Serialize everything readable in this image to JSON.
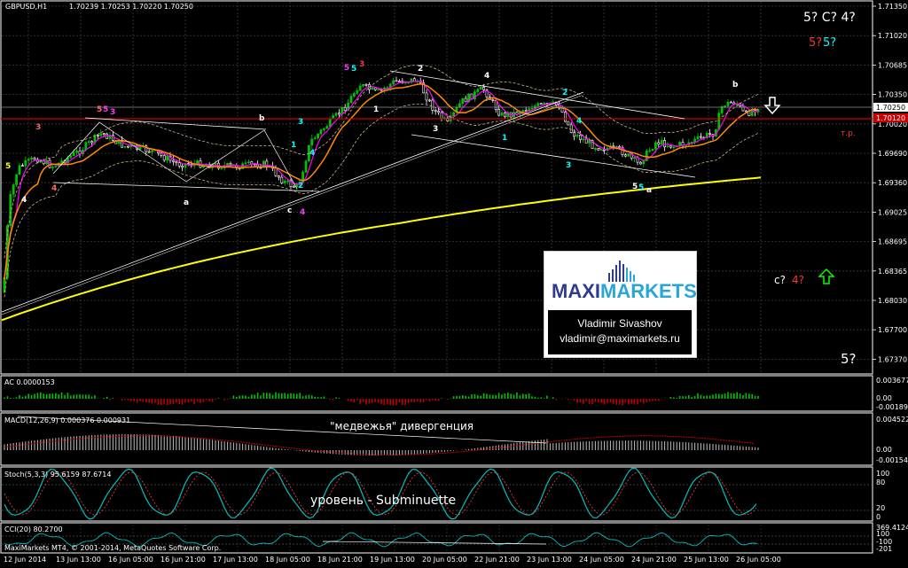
{
  "window": {
    "title": "GBPUSD,H1",
    "ohlc": "1.70239 1.70253 1.70220 1.70250"
  },
  "price_axis": {
    "ticks": [
      "1.71350",
      "1.71020",
      "1.70685",
      "1.70350",
      "1.70020",
      "1.69690",
      "1.69360",
      "1.69025",
      "1.68695",
      "1.68365",
      "1.68030",
      "1.67700",
      "1.67370"
    ],
    "current_price": "1.70250",
    "level_price": "1.70120"
  },
  "time_axis": {
    "ticks": [
      "12 Jun 2014",
      "13 Jun 13:00",
      "16 Jun 05:00",
      "16 Jun 21:00",
      "17 Jun 13:00",
      "18 Jun 05:00",
      "18 Jun 21:00",
      "19 Jun 13:00",
      "20 Jun 05:00",
      "22 Jun 21:00",
      "23 Jun 13:00",
      "24 Jun 05:00",
      "24 Jun 21:00",
      "25 Jun 13:00",
      "26 Jun 05:00"
    ]
  },
  "annotations": {
    "top_right": "5? C? 4?",
    "top_right2_a": "5?",
    "top_right2_b": "5?",
    "tp": "т.р.",
    "c4_a": "c?",
    "c4_b": "4?",
    "bottom_right": "5?",
    "bearish": "\"медвежья\" дивергенция",
    "level": "уровень - Subminuette"
  },
  "wave_labels": {
    "a1": "a",
    "b1": "b",
    "c1": "c",
    "four1": "4",
    "five_top": "5",
    "five_top_b": "5",
    "three_top": "3",
    "two_1": "2",
    "four_2": "4",
    "three_2": "3",
    "one_2": "1",
    "two_3": "2",
    "four_3": "4",
    "one_3": "1",
    "three_3": "3",
    "b_top": "b",
    "a_bottom": "a",
    "five_bot": "5",
    "five_bot_b": "5",
    "three_left": "3",
    "four_left": "4",
    "five_left": "5",
    "five_mid_a": "5",
    "five_mid_b": "5",
    "three_mid": "3",
    "i1": "1",
    "i2": "2",
    "i3": "3",
    "i4": "4",
    "i1b": "1"
  },
  "logo": {
    "brand_a": "MAXI",
    "brand_b": "MARKETS",
    "name": "Vladimir Sivashov",
    "email": "vladimir@maximarkets.ru"
  },
  "indicators": {
    "ac": {
      "label": "AC 0.0000153",
      "ticks": [
        "0.003677",
        "0.00",
        "-0.001897"
      ]
    },
    "macd": {
      "label": "MACD(12,26,9) 0.000376 0.000931",
      "ticks": [
        "0.004522",
        "0.00",
        "-0.001546"
      ]
    },
    "stoch": {
      "label": "Stoch(5,3,3) 95.6159 87.6714",
      "ticks": [
        "100",
        "80",
        "20",
        "0"
      ]
    },
    "cci": {
      "label": "CCI(20) 80.2700",
      "ticks": [
        "369.4124",
        "100",
        "-100",
        "-201"
      ]
    }
  },
  "footer": "MaxiMarkets MT4, © 2001-2014, MetaQuotes Software Corp.",
  "colors": {
    "background": "#000000",
    "up_candle": "#00c000",
    "down_candle": "#ffffff",
    "ma_slow": "#ffff00",
    "ma_mid": "#ff8c00",
    "ma_fast": "#ff00ff",
    "envelope": "#d2b48c",
    "level_line": "#cc0000",
    "wave_cyan": "#00ffff",
    "wave_red": "#ff3333",
    "wave_magenta": "#ff33ff",
    "signal_green": "#00ff00"
  }
}
